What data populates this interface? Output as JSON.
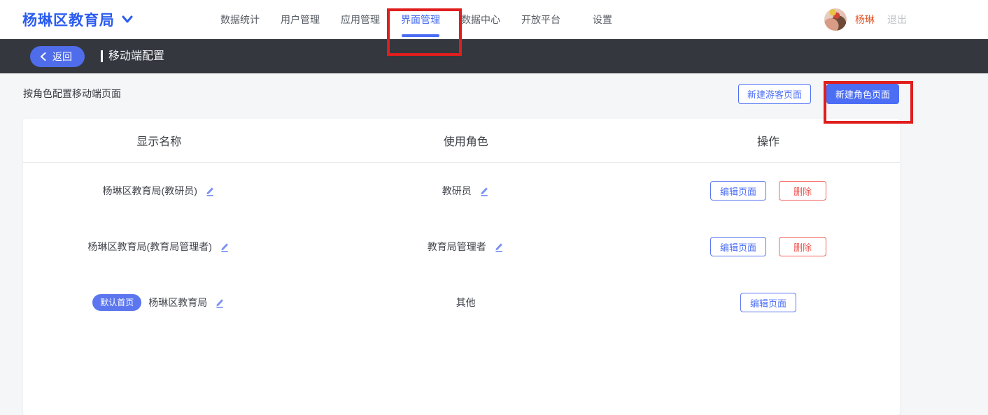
{
  "navbar": {
    "logo": "杨琳区教育局",
    "items": [
      {
        "label": "数据统计"
      },
      {
        "label": "用户管理"
      },
      {
        "label": "应用管理"
      },
      {
        "label": "界面管理"
      },
      {
        "label": "数据中心"
      },
      {
        "label": "开放平台"
      },
      {
        "label": "设置"
      }
    ],
    "active_item": "界面管理",
    "user": {
      "name": "杨琳",
      "logout_label": "退出"
    }
  },
  "subheader": {
    "back_label": "返回",
    "title": "移动端配置"
  },
  "toolbar": {
    "caption": "按角色配置移动端页面",
    "new_guest_page_label": "新建游客页面",
    "new_role_page_label": "新建角色页面"
  },
  "table": {
    "headers": [
      "显示名称",
      "使用角色",
      "操作"
    ],
    "rows": [
      {
        "name": "杨琳区教育局(教研员)",
        "role": "教研员",
        "edit_label": "编辑页面",
        "delete_label": "删除"
      },
      {
        "name": "杨琳区教育局(教育局管理者)",
        "role": "教育局管理者",
        "edit_label": "编辑页面",
        "delete_label": "删除"
      },
      {
        "badge": "默认首页",
        "name": "杨琳区教育局",
        "role": "其他",
        "edit_label": "编辑页面"
      }
    ]
  },
  "colors": {
    "accent_blue": "#4c6ef5",
    "logo_blue": "#2b5cf0",
    "danger_red": "#f0544e",
    "badge_blue": "#5b76ee",
    "dark_bar": "#35373f",
    "user_name_orange": "#e2572b",
    "annotation_red": "#e01e1e"
  }
}
